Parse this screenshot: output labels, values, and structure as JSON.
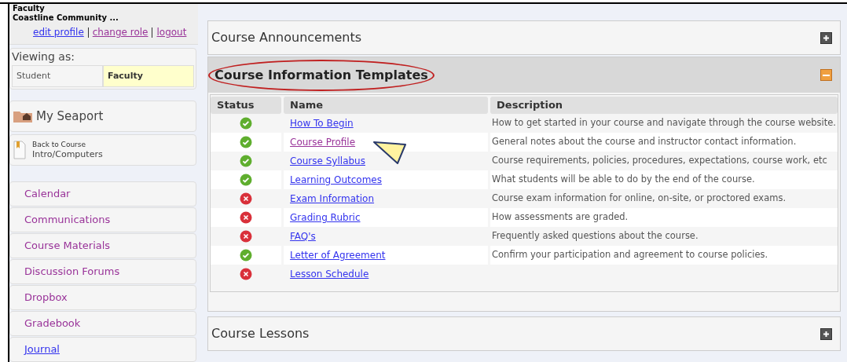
{
  "user": {
    "role": "Faculty",
    "org": "Coastline Community ...",
    "links": [
      {
        "label": "edit profile",
        "visited": false
      },
      {
        "label": "change role",
        "visited": true
      },
      {
        "label": "logout",
        "visited": true
      }
    ]
  },
  "viewing": {
    "label": "Viewing as:",
    "roles": [
      {
        "label": "Student",
        "selected": false
      },
      {
        "label": "Faculty",
        "selected": true
      }
    ]
  },
  "home": {
    "label": "My Seaport"
  },
  "back": {
    "label": "Back to Course",
    "course": "Intro/Computers"
  },
  "nav": [
    {
      "label": "Calendar",
      "visited": true
    },
    {
      "label": "Communications",
      "visited": true
    },
    {
      "label": "Course Materials",
      "visited": true
    },
    {
      "label": "Discussion Forums",
      "visited": true
    },
    {
      "label": "Dropbox",
      "visited": true
    },
    {
      "label": "Gradebook",
      "visited": true
    },
    {
      "label": "Journal",
      "visited": false
    }
  ],
  "panels": [
    {
      "title": "Course Announcements",
      "expanded": false
    },
    {
      "title": "Course Information Templates",
      "expanded": true,
      "highlighted": true,
      "table": {
        "columns": [
          "Status",
          "Name",
          "Description"
        ],
        "rows": [
          {
            "complete": true,
            "name": "How To Begin",
            "visited": false,
            "description": "How to get started in your course and navigate through the course website."
          },
          {
            "complete": true,
            "name": "Course Profile",
            "visited": true,
            "description": "General notes about the course and instructor contact information."
          },
          {
            "complete": true,
            "name": "Course Syllabus",
            "visited": false,
            "description": "Course requirements, policies, procedures, expectations, course work, etc"
          },
          {
            "complete": true,
            "name": "Learning Outcomes",
            "visited": false,
            "description": "What students will be able to do by the end of the course."
          },
          {
            "complete": false,
            "name": "Exam Information",
            "visited": false,
            "description": "Course exam information for online, on-site, or proctored exams."
          },
          {
            "complete": false,
            "name": "Grading Rubric",
            "visited": false,
            "description": "How assessments are graded."
          },
          {
            "complete": false,
            "name": "FAQ's",
            "visited": false,
            "description": "Frequently asked questions about the course."
          },
          {
            "complete": true,
            "name": "Letter of Agreement",
            "visited": false,
            "description": "Confirm your participation and agreement to course policies."
          },
          {
            "complete": false,
            "name": "Lesson Schedule",
            "visited": false
          }
        ]
      }
    },
    {
      "title": "Course Lessons",
      "expanded": false
    }
  ]
}
